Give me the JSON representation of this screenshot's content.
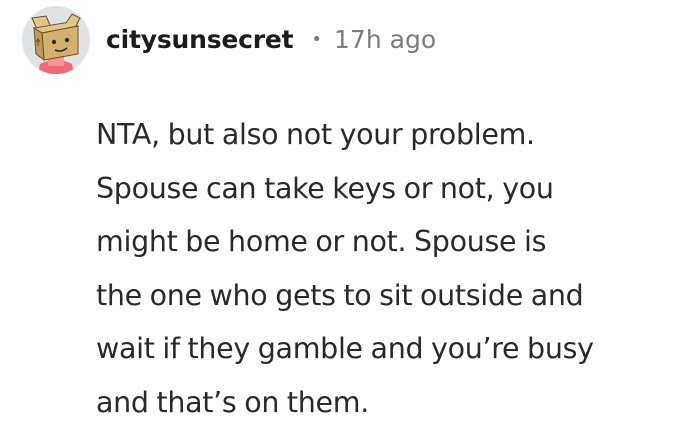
{
  "comment": {
    "author": "citysunsecret",
    "separator": "•",
    "timestamp": "17h ago",
    "avatar_icon": "cardboard-box-avatar-icon",
    "body_lines": [
      "NTA, but also not your problem.",
      "Spouse can take keys or not, you",
      "might be home or not. Spouse is",
      "the one who gets to sit outside and",
      "wait if they gamble and you’re busy",
      "and that’s on them."
    ]
  },
  "colors": {
    "username": "#1c1c1c",
    "meta": "#7c7c7c",
    "body": "#2a2a2a",
    "avatar_bg": "#dfe3e6"
  }
}
